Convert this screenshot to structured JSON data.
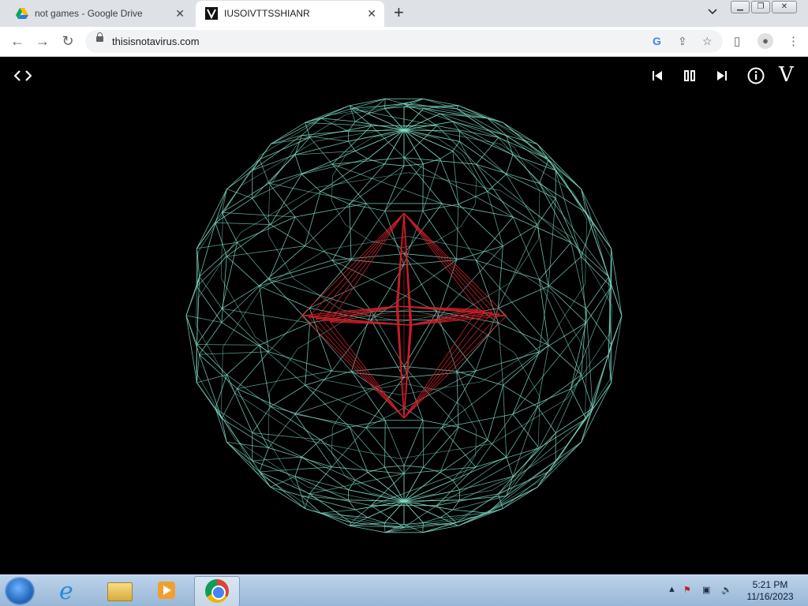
{
  "browser": {
    "tabs": [
      {
        "title": "not games - Google Drive",
        "favicon": "google-drive-icon",
        "active": false
      },
      {
        "title": "IUSOIVTTSSHIANR",
        "favicon": "v-logo-icon",
        "active": true
      }
    ],
    "url": "thisisnotavirus.com"
  },
  "page": {
    "brand_letter": "V",
    "background": "#000000",
    "sphere_color": "#7fdcc8",
    "octahedron_color": "#d0202a",
    "controls": [
      "embed-code-icon",
      "previous-icon",
      "pause-icon",
      "next-icon",
      "info-icon",
      "v-logo-icon"
    ]
  },
  "taskbar": {
    "apps": [
      "internet-explorer-icon",
      "file-explorer-icon",
      "media-player-icon",
      "chrome-icon"
    ],
    "time": "5:21 PM",
    "date": "11/16/2023"
  }
}
